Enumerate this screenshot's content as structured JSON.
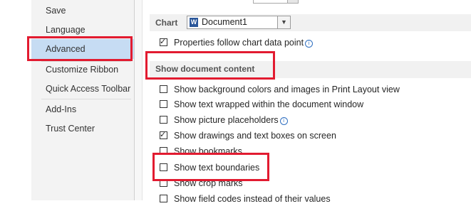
{
  "sidebar": {
    "items": [
      {
        "label": "Save"
      },
      {
        "label": "Language"
      },
      {
        "label": "Advanced",
        "selected": true
      },
      {
        "label": "Customize Ribbon"
      },
      {
        "label": "Quick Access Toolbar"
      },
      {
        "label": "Add-Ins"
      },
      {
        "label": "Trust Center"
      }
    ]
  },
  "chart": {
    "label": "Chart",
    "selected_document": "Document1",
    "doc_icon": "word-doc-icon",
    "follow_data_point": {
      "label": "Properties follow chart data point",
      "checked": true
    }
  },
  "show_document_content": {
    "title": "Show document content",
    "options": [
      {
        "label": "Show background colors and images in Print Layout view",
        "checked": false
      },
      {
        "label": "Show text wrapped within the document window",
        "checked": false
      },
      {
        "label": "Show picture placeholders",
        "checked": false,
        "info": true
      },
      {
        "label": "Show drawings and text boxes on screen",
        "checked": true
      },
      {
        "label": "Show bookmarks",
        "checked": false
      },
      {
        "label": "Show text boundaries",
        "checked": false
      },
      {
        "label": "Show crop marks",
        "checked": false
      },
      {
        "label": "Show field codes instead of their values",
        "checked": false
      }
    ]
  },
  "colors": {
    "highlight": "#e21b30",
    "selected_nav": "#c6dcf3"
  }
}
